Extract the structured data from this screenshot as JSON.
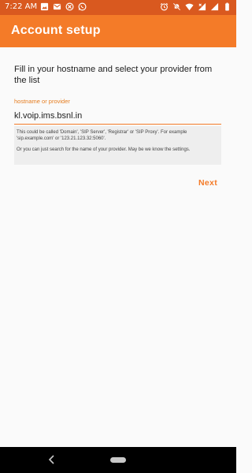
{
  "status_bar": {
    "time": "7:22 AM",
    "left_icons": [
      "image-icon",
      "gmail-icon",
      "blocked-icon",
      "whatsapp-icon"
    ],
    "right_icons": [
      "alarm-icon",
      "do-not-disturb-icon",
      "wifi-icon",
      "signal-x-icon",
      "signal-icon",
      "battery-icon"
    ]
  },
  "app_bar": {
    "title": "Account setup"
  },
  "content": {
    "instructions": "Fill in your hostname and select your provider from the list",
    "hostname_field": {
      "label": "hostname or provider",
      "value": "kl.voip.ims.bsnl.in"
    },
    "hint": {
      "line1": "This could be called 'Domain', 'SIP Server', 'Registrar' or 'SIP Proxy'. For example 'sip.example.com' or '123.21.123.32:5060'.",
      "line2": "Or you can just search for the name of your provider. May be we know the settings."
    },
    "next_label": "Next"
  },
  "colors": {
    "status_bar": "#d9591f",
    "app_bar": "#f47b28",
    "accent": "#f47b28",
    "background": "#fafafa",
    "hint_background": "#eeeeee"
  }
}
